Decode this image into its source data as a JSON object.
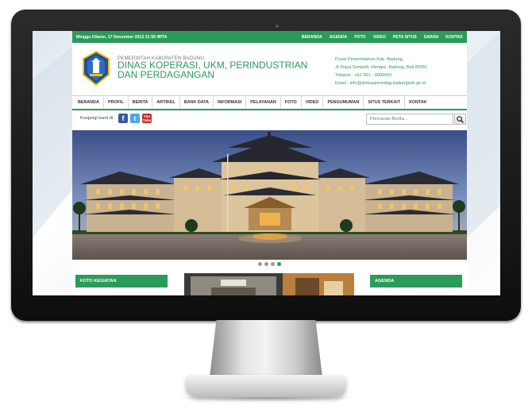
{
  "topbar": {
    "date": "Minggu Kliwon,  17 November 2013 21:56 WITA",
    "links": [
      "BERANDA",
      "AGENDA",
      "FOTO",
      "VIDEO",
      "PETA SITUS",
      "SARAN",
      "KONTAK"
    ]
  },
  "header": {
    "org_small": "PEMERINTAH KABUPATEN BADUNG",
    "org_big": "DINAS KOPERASI, UKM, PERINDUSTRIAN DAN PERDAGANGAN",
    "contact": [
      "Pusat Pemerintahan Kab. Badung,",
      "Jl. Raya Sempidi, Mengwi, Badung, Bali 80351",
      "Telepon : +62 361 - 9009410",
      "Email : info@diskopperindag.badungkab.go.id"
    ]
  },
  "nav": {
    "items": [
      "BERANDA",
      "PROFIL",
      "BERITA",
      "ARTIKEL",
      "BANK DATA",
      "INFORMASI",
      "PELAYANAN",
      "FOTO",
      "VIDEO",
      "PENGUMUMAN",
      "SITUS TERKAIT",
      "KONTAK"
    ]
  },
  "social": {
    "follow_label": "Kunjungi kami di",
    "facebook_glyph": "f",
    "twitter_glyph": "t",
    "youtube_glyph_1": "You",
    "youtube_glyph_2": "Tube"
  },
  "search": {
    "placeholder": "Pencarian Berita..."
  },
  "slider": {
    "total_slides": 4,
    "active_slide": 4
  },
  "widgets": {
    "foto_title": "FOTO KEGIATAN",
    "agenda_title": "AGENDA"
  },
  "colors": {
    "brand_green": "#2a9b59",
    "topbar_text": "#ffffff"
  }
}
